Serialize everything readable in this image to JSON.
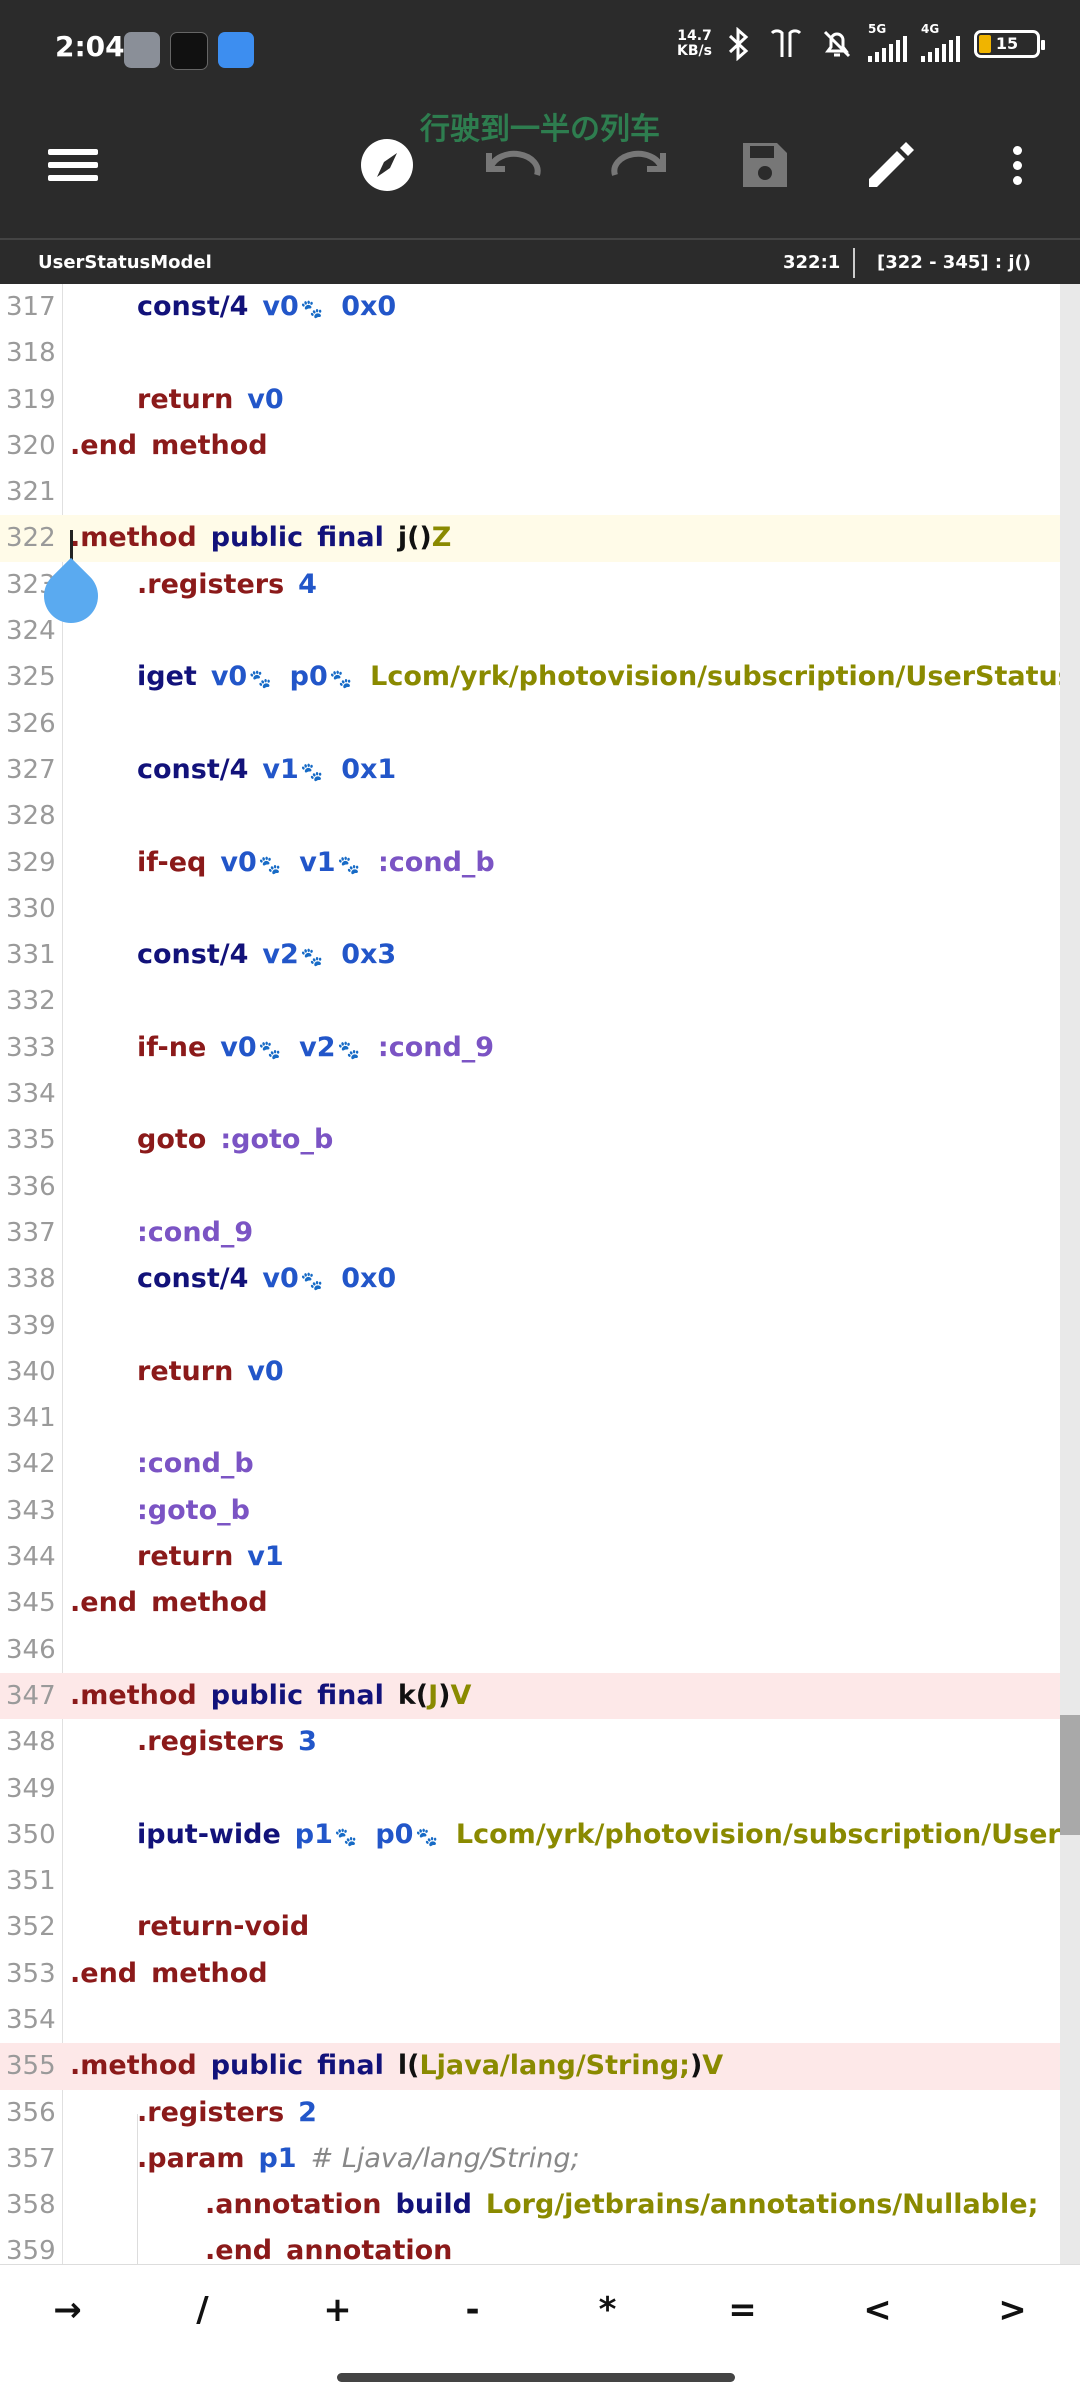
{
  "status_bar": {
    "time": "2:04",
    "net_speed_top": "14.7",
    "net_speed_bottom": "KB/s",
    "net_label_5g": "5G",
    "net_label_4g": "4G",
    "battery": "15",
    "colors": {
      "battery_fill": "#f0b400",
      "app1": "#8a8f98",
      "app2": "#111111",
      "app3": "#3d8ef0"
    }
  },
  "toolbar": {
    "title": "行驶到一半の列车",
    "icons": [
      "menu-icon",
      "compass-icon",
      "undo-icon",
      "redo-icon",
      "save-icon",
      "edit-icon",
      "more-icon"
    ]
  },
  "infobar": {
    "filename": "UserStatusModel",
    "cursor_pos": "322:1",
    "range": "[322 - 345] : j()"
  },
  "editor": {
    "lines": [
      {
        "n": "317",
        "indent": 1,
        "hl": "",
        "tokens": [
          [
            "kw",
            "const/4"
          ],
          [
            "reg",
            "v0"
          ],
          [
            "paw",
            "🐾"
          ],
          [
            "num",
            "0x0"
          ]
        ]
      },
      {
        "n": "318",
        "indent": 0,
        "hl": "",
        "tokens": []
      },
      {
        "n": "319",
        "indent": 1,
        "hl": "",
        "tokens": [
          [
            "dir",
            "return"
          ],
          [
            "reg",
            "v0"
          ]
        ]
      },
      {
        "n": "320",
        "indent": 0,
        "hl": "",
        "tokens": [
          [
            "dir",
            ".end"
          ],
          [
            "dir",
            "method"
          ]
        ]
      },
      {
        "n": "321",
        "indent": 0,
        "hl": "",
        "tokens": []
      },
      {
        "n": "322",
        "indent": 0,
        "hl": "yellow",
        "tokens": [
          [
            "dir",
            ".method"
          ],
          [
            "kw",
            "public"
          ],
          [
            "kw",
            "final"
          ],
          [
            "plain",
            "j()"
          ],
          [
            "type",
            "Z"
          ]
        ]
      },
      {
        "n": "323",
        "indent": 1,
        "hl": "",
        "tokens": [
          [
            "dir",
            ".registers"
          ],
          [
            "num",
            "4"
          ]
        ]
      },
      {
        "n": "324",
        "indent": 0,
        "hl": "",
        "tokens": []
      },
      {
        "n": "325",
        "indent": 1,
        "hl": "",
        "tokens": [
          [
            "kw",
            "iget"
          ],
          [
            "reg",
            "v0"
          ],
          [
            "paw",
            "🐾"
          ],
          [
            "reg",
            "p0"
          ],
          [
            "paw",
            "🐾"
          ],
          [
            "type",
            "Lcom/yrk/photovision/subscription/UserStatusModel;->a"
          ]
        ]
      },
      {
        "n": "326",
        "indent": 0,
        "hl": "",
        "tokens": []
      },
      {
        "n": "327",
        "indent": 1,
        "hl": "",
        "tokens": [
          [
            "kw",
            "const/4"
          ],
          [
            "reg",
            "v1"
          ],
          [
            "paw",
            "🐾"
          ],
          [
            "num",
            "0x1"
          ]
        ]
      },
      {
        "n": "328",
        "indent": 0,
        "hl": "",
        "tokens": []
      },
      {
        "n": "329",
        "indent": 1,
        "hl": "",
        "tokens": [
          [
            "dir",
            "if-eq"
          ],
          [
            "reg",
            "v0"
          ],
          [
            "paw",
            "🐾"
          ],
          [
            "reg",
            "v1"
          ],
          [
            "paw",
            "🐾"
          ],
          [
            "label",
            ":cond_b"
          ]
        ]
      },
      {
        "n": "330",
        "indent": 0,
        "hl": "",
        "tokens": []
      },
      {
        "n": "331",
        "indent": 1,
        "hl": "",
        "tokens": [
          [
            "kw",
            "const/4"
          ],
          [
            "reg",
            "v2"
          ],
          [
            "paw",
            "🐾"
          ],
          [
            "num",
            "0x3"
          ]
        ]
      },
      {
        "n": "332",
        "indent": 0,
        "hl": "",
        "tokens": []
      },
      {
        "n": "333",
        "indent": 1,
        "hl": "",
        "tokens": [
          [
            "dir",
            "if-ne"
          ],
          [
            "reg",
            "v0"
          ],
          [
            "paw",
            "🐾"
          ],
          [
            "reg",
            "v2"
          ],
          [
            "paw",
            "🐾"
          ],
          [
            "label",
            ":cond_9"
          ]
        ]
      },
      {
        "n": "334",
        "indent": 0,
        "hl": "",
        "tokens": []
      },
      {
        "n": "335",
        "indent": 1,
        "hl": "",
        "tokens": [
          [
            "dir",
            "goto"
          ],
          [
            "label",
            ":goto_b"
          ]
        ]
      },
      {
        "n": "336",
        "indent": 0,
        "hl": "",
        "tokens": []
      },
      {
        "n": "337",
        "indent": 1,
        "hl": "",
        "tokens": [
          [
            "label",
            ":cond_9"
          ]
        ]
      },
      {
        "n": "338",
        "indent": 1,
        "hl": "",
        "tokens": [
          [
            "kw",
            "const/4"
          ],
          [
            "reg",
            "v0"
          ],
          [
            "paw",
            "🐾"
          ],
          [
            "num",
            "0x0"
          ]
        ]
      },
      {
        "n": "339",
        "indent": 0,
        "hl": "",
        "tokens": []
      },
      {
        "n": "340",
        "indent": 1,
        "hl": "",
        "tokens": [
          [
            "dir",
            "return"
          ],
          [
            "reg",
            "v0"
          ]
        ]
      },
      {
        "n": "341",
        "indent": 0,
        "hl": "",
        "tokens": []
      },
      {
        "n": "342",
        "indent": 1,
        "hl": "",
        "tokens": [
          [
            "label",
            ":cond_b"
          ]
        ]
      },
      {
        "n": "343",
        "indent": 1,
        "hl": "",
        "tokens": [
          [
            "label",
            ":goto_b"
          ]
        ]
      },
      {
        "n": "344",
        "indent": 1,
        "hl": "",
        "tokens": [
          [
            "dir",
            "return"
          ],
          [
            "reg",
            "v1"
          ]
        ]
      },
      {
        "n": "345",
        "indent": 0,
        "hl": "",
        "tokens": [
          [
            "dir",
            ".end"
          ],
          [
            "dir",
            "method"
          ]
        ]
      },
      {
        "n": "346",
        "indent": 0,
        "hl": "",
        "tokens": []
      },
      {
        "n": "347",
        "indent": 0,
        "hl": "red",
        "tokens": [
          [
            "dir",
            ".method"
          ],
          [
            "kw",
            "public"
          ],
          [
            "kw",
            "final"
          ],
          [
            "plain",
            "k("
          ],
          [
            "type",
            "J"
          ],
          [
            "plain",
            ")"
          ],
          [
            "type",
            "V"
          ]
        ]
      },
      {
        "n": "348",
        "indent": 1,
        "hl": "",
        "tokens": [
          [
            "dir",
            ".registers"
          ],
          [
            "num",
            "3"
          ]
        ]
      },
      {
        "n": "349",
        "indent": 0,
        "hl": "",
        "tokens": []
      },
      {
        "n": "350",
        "indent": 1,
        "hl": "",
        "tokens": [
          [
            "kw",
            "iput-wide"
          ],
          [
            "reg",
            "p1"
          ],
          [
            "paw",
            "🐾"
          ],
          [
            "reg",
            "p0"
          ],
          [
            "paw",
            "🐾"
          ],
          [
            "type",
            "Lcom/yrk/photovision/subscription/UserStatusMode"
          ]
        ]
      },
      {
        "n": "351",
        "indent": 0,
        "hl": "",
        "tokens": []
      },
      {
        "n": "352",
        "indent": 1,
        "hl": "",
        "tokens": [
          [
            "dir",
            "return-void"
          ]
        ]
      },
      {
        "n": "353",
        "indent": 0,
        "hl": "",
        "tokens": [
          [
            "dir",
            ".end"
          ],
          [
            "dir",
            "method"
          ]
        ]
      },
      {
        "n": "354",
        "indent": 0,
        "hl": "",
        "tokens": []
      },
      {
        "n": "355",
        "indent": 0,
        "hl": "red",
        "tokens": [
          [
            "dir",
            ".method"
          ],
          [
            "kw",
            "public"
          ],
          [
            "kw",
            "final"
          ],
          [
            "plain",
            "l("
          ],
          [
            "type",
            "Ljava/lang/String;"
          ],
          [
            "plain",
            ")"
          ],
          [
            "type",
            "V"
          ]
        ]
      },
      {
        "n": "356",
        "indent": 1,
        "hl": "",
        "tokens": [
          [
            "dir",
            ".registers"
          ],
          [
            "num",
            "2"
          ]
        ]
      },
      {
        "n": "357",
        "indent": 1,
        "hl": "",
        "tokens": [
          [
            "dir",
            ".param"
          ],
          [
            "reg",
            "p1"
          ],
          [
            "comment",
            "# Ljava/lang/String;"
          ]
        ]
      },
      {
        "n": "358",
        "indent": 2,
        "hl": "",
        "tokens": [
          [
            "dir",
            ".annotation"
          ],
          [
            "kw",
            "build"
          ],
          [
            "type",
            "Lorg/jetbrains/annotations/Nullable;"
          ]
        ]
      },
      {
        "n": "359",
        "indent": 2,
        "hl": "",
        "tokens": [
          [
            "dir",
            ".end"
          ],
          [
            "dir",
            "annotation"
          ]
        ]
      }
    ]
  },
  "keybar": {
    "keys": [
      "→",
      "/",
      "+",
      "-",
      "*",
      "=",
      "<",
      ">"
    ]
  }
}
